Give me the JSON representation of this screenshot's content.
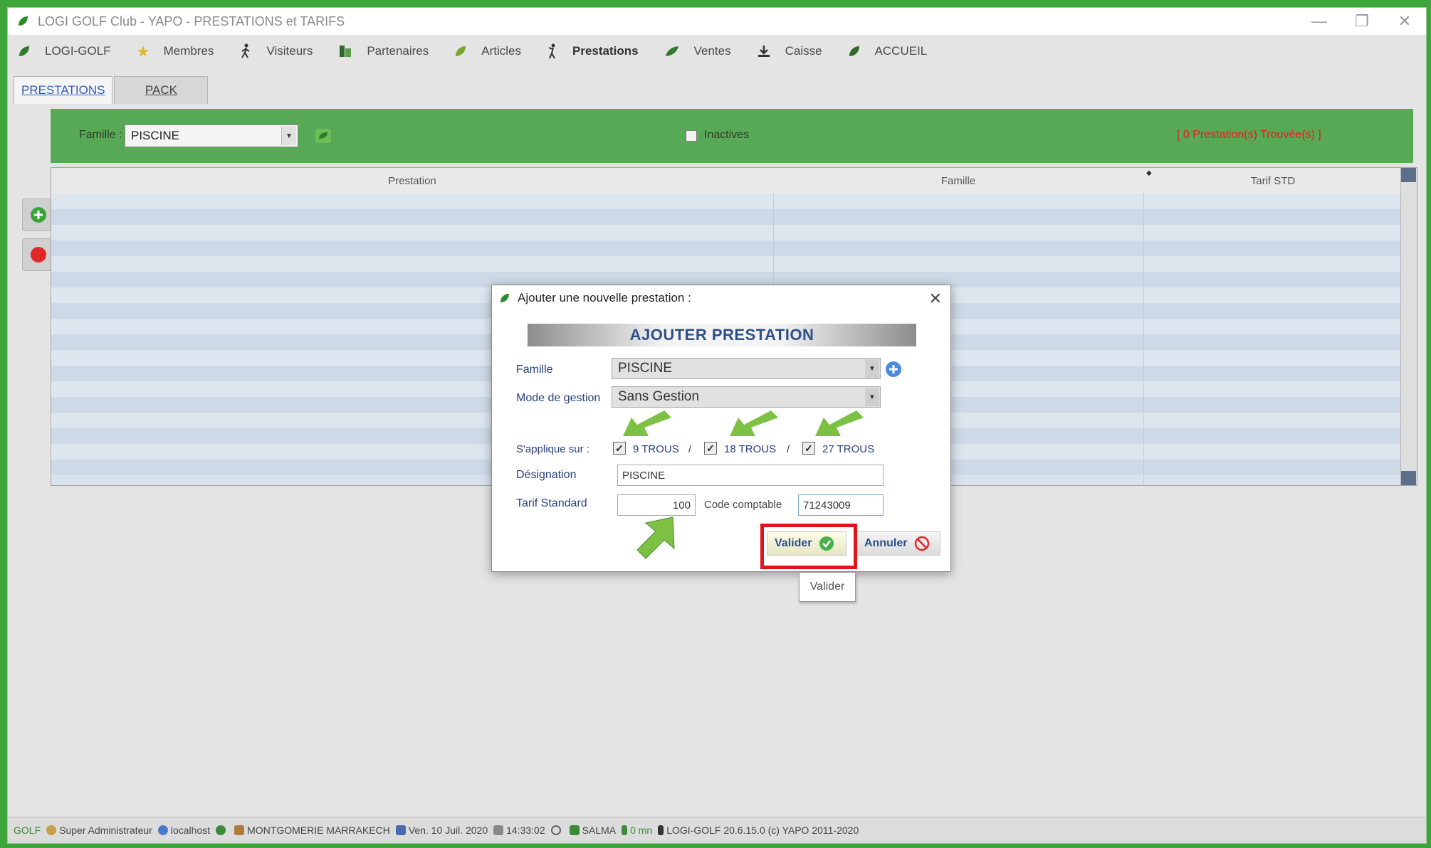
{
  "window": {
    "title": "LOGI GOLF Club - YAPO - PRESTATIONS et TARIFS"
  },
  "menu": [
    {
      "label": "LOGI-GOLF",
      "icon": "leaf-icon"
    },
    {
      "label": "Membres",
      "icon": "star-icon"
    },
    {
      "label": "Visiteurs",
      "icon": "walker-icon"
    },
    {
      "label": "Partenaires",
      "icon": "partners-icon"
    },
    {
      "label": "Articles",
      "icon": "leaf-icon"
    },
    {
      "label": "Prestations",
      "icon": "golfer-icon"
    },
    {
      "label": "Ventes",
      "icon": "leaf-icon"
    },
    {
      "label": "Caisse",
      "icon": "download-icon"
    },
    {
      "label": "ACCUEIL",
      "icon": "leaf-icon"
    }
  ],
  "tabs": [
    {
      "label": "PRESTATIONS",
      "active": true
    },
    {
      "label": "PACK",
      "active": false
    }
  ],
  "filter": {
    "famille_label": "Famille :",
    "famille_value": "PISCINE",
    "inactives_label": "Inactives",
    "found_text": "[ 0 Prestation(s) Trouvée(s) ]"
  },
  "grid": {
    "columns": [
      "Prestation",
      "Famille",
      "Tarif STD"
    ]
  },
  "dialog": {
    "title": "Ajouter une nouvelle prestation :",
    "banner": "AJOUTER PRESTATION",
    "famille_label": "Famille",
    "famille_value": "PISCINE",
    "mode_label": "Mode de gestion",
    "mode_value": "Sans Gestion",
    "applique_label": "S'applique sur :",
    "options": [
      {
        "label": "9 TROUS",
        "checked": true
      },
      {
        "label": "18 TROUS",
        "checked": true
      },
      {
        "label": "27 TROUS",
        "checked": true
      }
    ],
    "separator": "/",
    "designation_label": "Désignation",
    "designation_value": "PISCINE",
    "tarif_label": "Tarif Standard",
    "tarif_value": "100",
    "code_label": "Code comptable",
    "code_value": "71243009",
    "valider_label": "Valider",
    "annuler_label": "Annuler",
    "tooltip": "Valider"
  },
  "status": [
    {
      "label": "GOLF",
      "icon": "golf-icon"
    },
    {
      "label": "Super Administrateur",
      "icon": "user-icon"
    },
    {
      "label": "localhost",
      "icon": "globe-icon"
    },
    {
      "label": "",
      "icon": "leaf-icon"
    },
    {
      "label": "MONTGOMERIE MARRAKECH",
      "icon": "building-icon"
    },
    {
      "label": "Ven. 10 Juil. 2020",
      "icon": "calendar-icon"
    },
    {
      "label": "14:33:02",
      "icon": "hourglass-icon"
    },
    {
      "label": "",
      "icon": "refresh-icon"
    },
    {
      "label": "SALMA",
      "icon": "arrow-icon"
    },
    {
      "label": "0 mn",
      "icon": "person-icon"
    },
    {
      "label": "LOGI-GOLF 20.6.15.0 (c) YAPO 2011-2020",
      "icon": "golfer-icon"
    }
  ],
  "colors": {
    "frame": "#3ea53a",
    "filterbar": "#58a955",
    "found_text": "#e02020",
    "highlight": "#e3131b",
    "arrow": "#7cc144"
  }
}
